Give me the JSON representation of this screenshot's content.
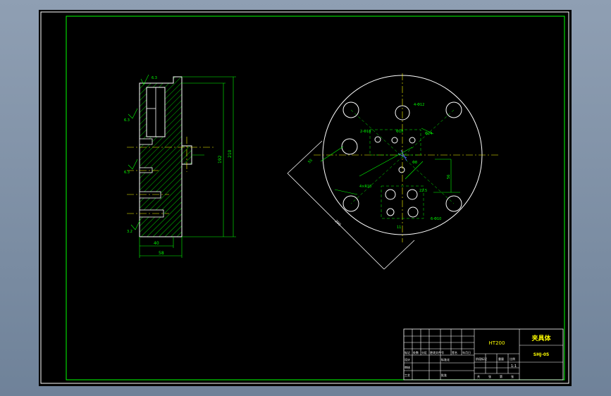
{
  "colors": {
    "background": "#000000",
    "frame": "#ffffff",
    "border": "#00ff00",
    "part": "#ffffff",
    "hatch": "#00ff00",
    "dimension": "#00ff00",
    "centerline": "#ffff00",
    "title_text": "#ffff00",
    "desktop": "#7c8da3"
  },
  "title_block": {
    "material": "HT200",
    "part_name": "夹具体",
    "drawing_number": "SHJ-05",
    "scale": "1:1",
    "header_labels": [
      "标记",
      "处数",
      "分区",
      "更改文件号",
      "签名",
      "年月日"
    ],
    "approval_labels": [
      "设计",
      "标准化",
      "审核",
      "工艺",
      "批准"
    ],
    "stage_labels": [
      "阶段标记",
      "重量",
      "比例"
    ],
    "sheet_labels": [
      "共",
      "张",
      "第",
      "张"
    ]
  },
  "side_view": {
    "dimensions": [
      "40",
      "58",
      "192",
      "210"
    ],
    "roughness": [
      "6.3",
      "6.3",
      "6.3",
      "3.2"
    ]
  },
  "top_view": {
    "dimensions": [
      "4-Φ12",
      "2-Φ18",
      "Φ18",
      "Φ24",
      "4×R18",
      "200",
      "55",
      "11",
      "56",
      "22.5",
      "Φ8",
      "6-Φ10"
    ]
  }
}
